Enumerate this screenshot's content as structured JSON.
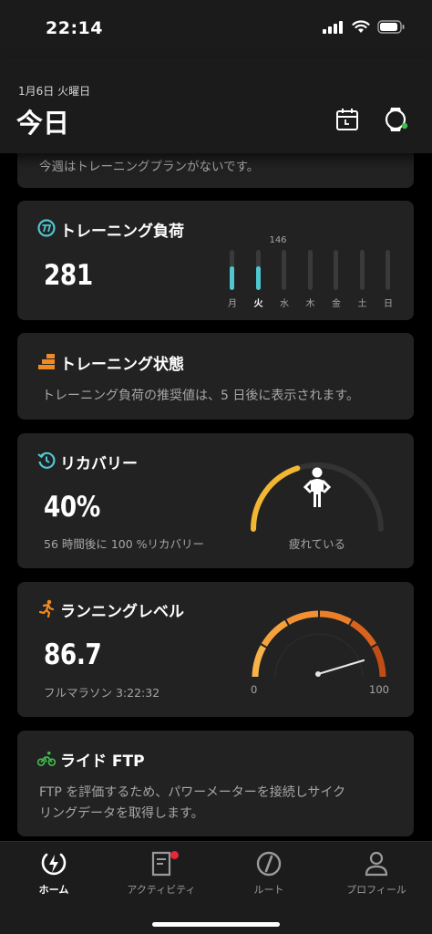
{
  "status_bar": {
    "time": "22:14"
  },
  "header": {
    "date": "1月6日 火曜日",
    "title": "今日"
  },
  "plan_card": {
    "text": "今週はトレーニングプランがないです。"
  },
  "load_card": {
    "title": "トレーニング負荷",
    "value": "281",
    "peak_label": "146",
    "days": [
      {
        "label": "月",
        "level": 0.58
      },
      {
        "label": "火",
        "level": 0.58,
        "today": true
      },
      {
        "label": "水",
        "level": 0
      },
      {
        "label": "木",
        "level": 0
      },
      {
        "label": "金",
        "level": 0
      },
      {
        "label": "土",
        "level": 0
      },
      {
        "label": "日",
        "level": 0
      }
    ]
  },
  "state_card": {
    "title": "トレーニング状態",
    "text": "トレーニング負荷の推奨値は、5 日後に表示されます。"
  },
  "recovery_card": {
    "title": "リカバリー",
    "value": "40%",
    "subtitle": "56 時間後に 100 %リカバリー",
    "gauge_label": "疲れている",
    "gauge_value": 0.4
  },
  "running_card": {
    "title": "ランニングレベル",
    "value": "86.7",
    "subtitle": "フルマラソン 3:22:32",
    "gauge_min": "0",
    "gauge_max": "100",
    "gauge_value": 0.867
  },
  "ftp_card": {
    "title": "ライド FTP",
    "line1": "FTP を評価するため、パワーメーターを接続しサイク",
    "line2": "リングデータを取得します。"
  },
  "nav": {
    "home": "ホーム",
    "activity": "アクティビティ",
    "route": "ルート",
    "profile": "プロフィール"
  },
  "colors": {
    "accent_teal": "#4fc7d1",
    "recovery_yellow": "#f2b632",
    "running_orange": "#f08a24",
    "notification_red": "#e8273a",
    "ride_green": "#3fbf4a"
  }
}
